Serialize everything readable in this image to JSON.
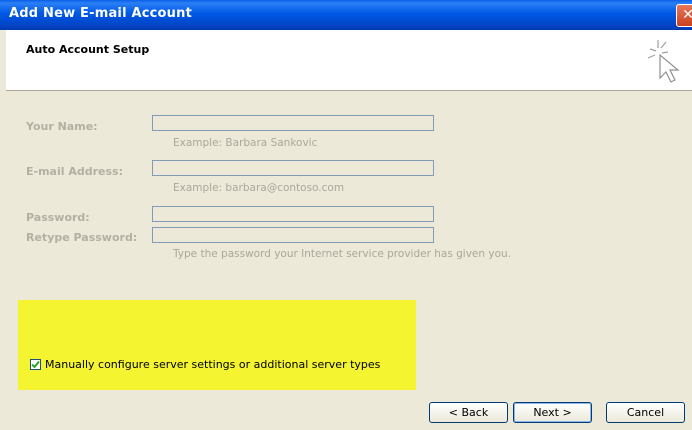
{
  "window": {
    "title": "Add New E-mail Account",
    "close_glyph": "✕"
  },
  "header": {
    "title": "Auto Account Setup",
    "icon": "sparkle-cursor-icon"
  },
  "form": {
    "your_name": {
      "label": "Your Name:",
      "value": "",
      "hint": "Example: Barbara Sankovic"
    },
    "email": {
      "label": "E-mail Address:",
      "value": "",
      "hint": "Example: barbara@contoso.com"
    },
    "password": {
      "label": "Password:",
      "value": ""
    },
    "retype_password": {
      "label": "Retype Password:",
      "value": "",
      "hint": "Type the password your Internet service provider has given you."
    }
  },
  "manual_config": {
    "label": "Manually configure server settings or additional server types",
    "checked": true,
    "highlight_color": "#f4f431"
  },
  "buttons": {
    "back": "< Back",
    "next": "Next >",
    "cancel": "Cancel"
  },
  "colors": {
    "titlebar": "#0058e6",
    "dialog_bg": "#ece9d8",
    "disabled_text": "#b3b0a3"
  }
}
